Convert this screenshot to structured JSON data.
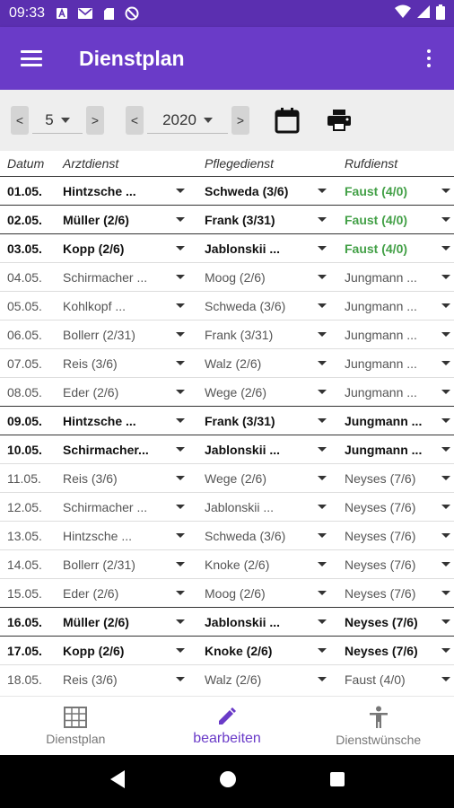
{
  "status_bar": {
    "time": "09:33"
  },
  "app_bar": {
    "title": "Dienstplan"
  },
  "toolbar": {
    "month": "5",
    "year": "2020",
    "prev": "<",
    "next": ">"
  },
  "table": {
    "headers": {
      "date": "Datum",
      "arzt": "Arztdienst",
      "pflege": "Pflegedienst",
      "ruf": "Rufdienst"
    },
    "rows": [
      {
        "date": "01.05.",
        "arzt": "Hintzsche ...",
        "pflege": "Schweda (3/6)",
        "ruf": "Faust (4/0)",
        "bold": true,
        "ruf_green": true
      },
      {
        "date": "02.05.",
        "arzt": "Müller (2/6)",
        "pflege": "Frank (3/31)",
        "ruf": "Faust (4/0)",
        "bold": true,
        "ruf_green": true
      },
      {
        "date": "03.05.",
        "arzt": "Kopp (2/6)",
        "pflege": "Jablonskii ...",
        "ruf": "Faust (4/0)",
        "bold": true,
        "ruf_green": true
      },
      {
        "date": "04.05.",
        "arzt": "Schirmacher ...",
        "pflege": "Moog (2/6)",
        "ruf": "Jungmann ...",
        "bold": false,
        "ruf_green": false
      },
      {
        "date": "05.05.",
        "arzt": "Kohlkopf ...",
        "pflege": "Schweda (3/6)",
        "ruf": "Jungmann ...",
        "bold": false,
        "ruf_green": false
      },
      {
        "date": "06.05.",
        "arzt": "Bollerr (2/31)",
        "pflege": "Frank (3/31)",
        "ruf": "Jungmann ...",
        "bold": false,
        "ruf_green": false
      },
      {
        "date": "07.05.",
        "arzt": "Reis (3/6)",
        "pflege": "Walz (2/6)",
        "ruf": "Jungmann ...",
        "bold": false,
        "ruf_green": false
      },
      {
        "date": "08.05.",
        "arzt": "Eder (2/6)",
        "pflege": "Wege (2/6)",
        "ruf": "Jungmann ...",
        "bold": false,
        "ruf_green": false
      },
      {
        "date": "09.05.",
        "arzt": "Hintzsche ...",
        "pflege": "Frank (3/31)",
        "ruf": "Jungmann ...",
        "bold": true,
        "ruf_green": false
      },
      {
        "date": "10.05.",
        "arzt": "Schirmacher...",
        "pflege": "Jablonskii ...",
        "ruf": "Jungmann ...",
        "bold": true,
        "ruf_green": false
      },
      {
        "date": "11.05.",
        "arzt": "Reis (3/6)",
        "pflege": "Wege (2/6)",
        "ruf": "Neyses (7/6)",
        "bold": false,
        "ruf_green": false
      },
      {
        "date": "12.05.",
        "arzt": "Schirmacher ...",
        "pflege": "Jablonskii ...",
        "ruf": "Neyses (7/6)",
        "bold": false,
        "ruf_green": false
      },
      {
        "date": "13.05.",
        "arzt": "Hintzsche ...",
        "pflege": "Schweda (3/6)",
        "ruf": "Neyses (7/6)",
        "bold": false,
        "ruf_green": false
      },
      {
        "date": "14.05.",
        "arzt": "Bollerr (2/31)",
        "pflege": "Knoke (2/6)",
        "ruf": "Neyses (7/6)",
        "bold": false,
        "ruf_green": false
      },
      {
        "date": "15.05.",
        "arzt": "Eder (2/6)",
        "pflege": "Moog (2/6)",
        "ruf": "Neyses (7/6)",
        "bold": false,
        "ruf_green": false
      },
      {
        "date": "16.05.",
        "arzt": "Müller (2/6)",
        "pflege": "Jablonskii ...",
        "ruf": "Neyses (7/6)",
        "bold": true,
        "ruf_green": false
      },
      {
        "date": "17.05.",
        "arzt": "Kopp (2/6)",
        "pflege": "Knoke (2/6)",
        "ruf": "Neyses (7/6)",
        "bold": true,
        "ruf_green": false
      },
      {
        "date": "18.05.",
        "arzt": "Reis (3/6)",
        "pflege": "Walz (2/6)",
        "ruf": "Faust (4/0)",
        "bold": false,
        "ruf_green": false
      }
    ]
  },
  "bottom_nav": [
    {
      "label": "Dienstplan",
      "icon": "grid-icon",
      "active": false
    },
    {
      "label": "bearbeiten",
      "icon": "pencil-icon",
      "active": true
    },
    {
      "label": "Dienstwünsche",
      "icon": "person-icon",
      "active": false
    }
  ],
  "colors": {
    "status_bar": "#5b2fb0",
    "app_bar": "#6a3bc8",
    "accent": "#6a3bc8",
    "green": "#43a047"
  }
}
